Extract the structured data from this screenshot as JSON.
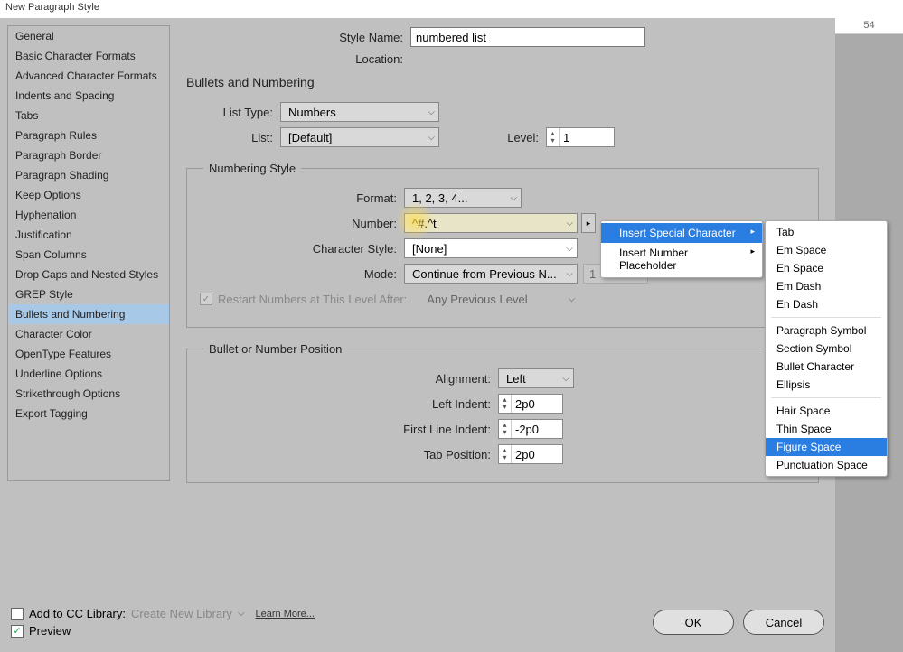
{
  "window_title": "New Paragraph Style",
  "ruler_value": "54",
  "sidebar": {
    "items": [
      "General",
      "Basic Character Formats",
      "Advanced Character Formats",
      "Indents and Spacing",
      "Tabs",
      "Paragraph Rules",
      "Paragraph Border",
      "Paragraph Shading",
      "Keep Options",
      "Hyphenation",
      "Justification",
      "Span Columns",
      "Drop Caps and Nested Styles",
      "GREP Style",
      "Bullets and Numbering",
      "Character Color",
      "OpenType Features",
      "Underline Options",
      "Strikethrough Options",
      "Export Tagging"
    ],
    "selected_index": 14
  },
  "header": {
    "style_name_label": "Style Name:",
    "style_name_value": "numbered list",
    "location_label": "Location:",
    "location_value": ""
  },
  "section_title": "Bullets and Numbering",
  "list_type": {
    "label": "List Type:",
    "value": "Numbers"
  },
  "list": {
    "label": "List:",
    "value": "[Default]"
  },
  "level": {
    "label": "Level:",
    "value": "1"
  },
  "numbering_style_legend": "Numbering Style",
  "format": {
    "label": "Format:",
    "value": "1, 2, 3, 4..."
  },
  "number": {
    "label": "Number:",
    "value": "^#.^t"
  },
  "char_style": {
    "label": "Character Style:",
    "value": "[None]"
  },
  "mode": {
    "label": "Mode:",
    "value": "Continue from Previous N...",
    "aux": "1"
  },
  "restart": {
    "label": "Restart Numbers at This Level After:",
    "value": "Any Previous Level"
  },
  "position_legend": "Bullet or Number Position",
  "alignment": {
    "label": "Alignment:",
    "value": "Left"
  },
  "left_indent": {
    "label": "Left Indent:",
    "value": "2p0"
  },
  "first_line_indent": {
    "label": "First Line Indent:",
    "value": "-2p0"
  },
  "tab_position": {
    "label": "Tab Position:",
    "value": "2p0"
  },
  "footer": {
    "add_cc_label": "Add to CC Library:",
    "add_cc_checked": false,
    "create_label": "Create New Library",
    "learn_more": "Learn More...",
    "preview_label": "Preview",
    "preview_checked": true,
    "ok": "OK",
    "cancel": "Cancel"
  },
  "ctx_menu1": {
    "items": [
      {
        "label": "Insert Special Character",
        "submenu": true,
        "selected": true
      },
      {
        "label": "Insert Number Placeholder",
        "submenu": true,
        "selected": false
      }
    ]
  },
  "ctx_menu2": {
    "groups": [
      [
        "Tab",
        "Em Space",
        "En Space",
        "Em Dash",
        "En Dash"
      ],
      [
        "Paragraph Symbol",
        "Section Symbol",
        "Bullet Character",
        "Ellipsis"
      ],
      [
        "Hair Space",
        "Thin Space",
        "Figure Space",
        "Punctuation Space"
      ]
    ],
    "selected": "Figure Space"
  }
}
